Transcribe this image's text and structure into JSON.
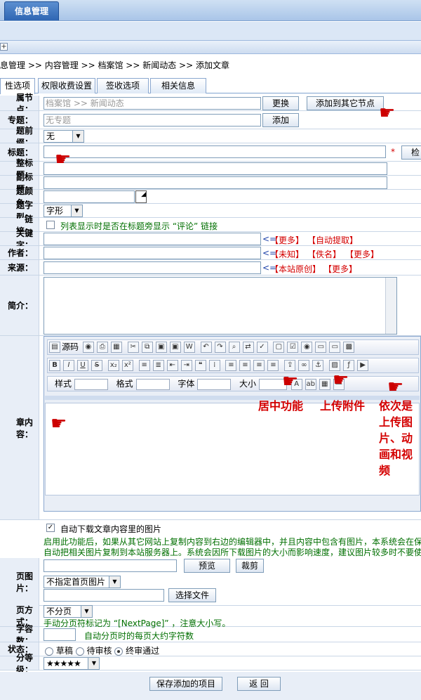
{
  "top_tab": "信息管理",
  "breadcrumb": "息管理 >> 内容管理 >> 档案馆 >> 新闻动态 >> 添加文章",
  "tabs": [
    "性选项",
    "权限收费设置",
    "签收选项",
    "相关信息"
  ],
  "fields": {
    "node_label": "属节点：",
    "node_value": "档案馆 >> 新闻动态",
    "node_change": "更换",
    "node_add_other": "添加到其它节点",
    "topic_label": "专题：",
    "topic_value": "无专题",
    "topic_add": "添加",
    "prefix_label": "题前缀：",
    "prefix_value": "无",
    "title_label": "标题：",
    "title_required": "*",
    "title_check": "检",
    "full_title_label": "整标题：",
    "sub_title_label": "副标题：",
    "color_label": "题颜色：",
    "font_label": "题字型：",
    "font_value": "字形",
    "link_label": "” 链接：",
    "link_text": "列表显示时是否在标题旁显示 “评论” 链接",
    "keyword_label": "关键字：",
    "keyword_more": "【更多】",
    "keyword_auto": "【自动提取】",
    "author_label": "作者：",
    "author_unknown": "【未知】",
    "author_anon": "【佚名】",
    "author_more": "【更多】",
    "source_label": "来源：",
    "source_original": "【本站原创】",
    "source_more": "【更多】",
    "intro_label": "简介：",
    "content_label": "章内容：",
    "arrow": "<=",
    "download_label": "自动下载文章内容里的图片",
    "download_note1": "启用此功能后，如果从其它网站上复制内容到右边的编辑器中，并且内容中包含有图片，本系统会在保",
    "download_note2": "自动把相关图片复制到本站服务器上。系统会因所下载图片的大小而影响速度，建议图片较多时不要使",
    "preview_btn": "预览",
    "crop_btn": "裁剪",
    "homepic_label": "页图片：",
    "homepic_value": "不指定首页图片",
    "choose_file": "选择文件",
    "paging_label": "页方式：",
    "paging_value": "不分页",
    "paging_note": "手动分页符标记为 “[NextPage]” ，注意大小写。",
    "charcount_label": "字容数：",
    "charcount_note": "自动分页时的每页大约字符数",
    "status_label": "状态：",
    "status_draft": "草稿",
    "status_pending": "待审核",
    "status_approved": "终审通过",
    "rating_label": "分等级：",
    "rating_value": "★★★★★",
    "save_btn": "保存添加的项目",
    "back_btn": "返  回"
  },
  "editor": {
    "source": "源码",
    "style": "样式",
    "format": "格式",
    "font": "字体",
    "size": "大小"
  },
  "annotations": {
    "center": "居中功能",
    "upload": "上传附件",
    "media": "依次是\n上传图\n片、动\n画和视\n频"
  }
}
